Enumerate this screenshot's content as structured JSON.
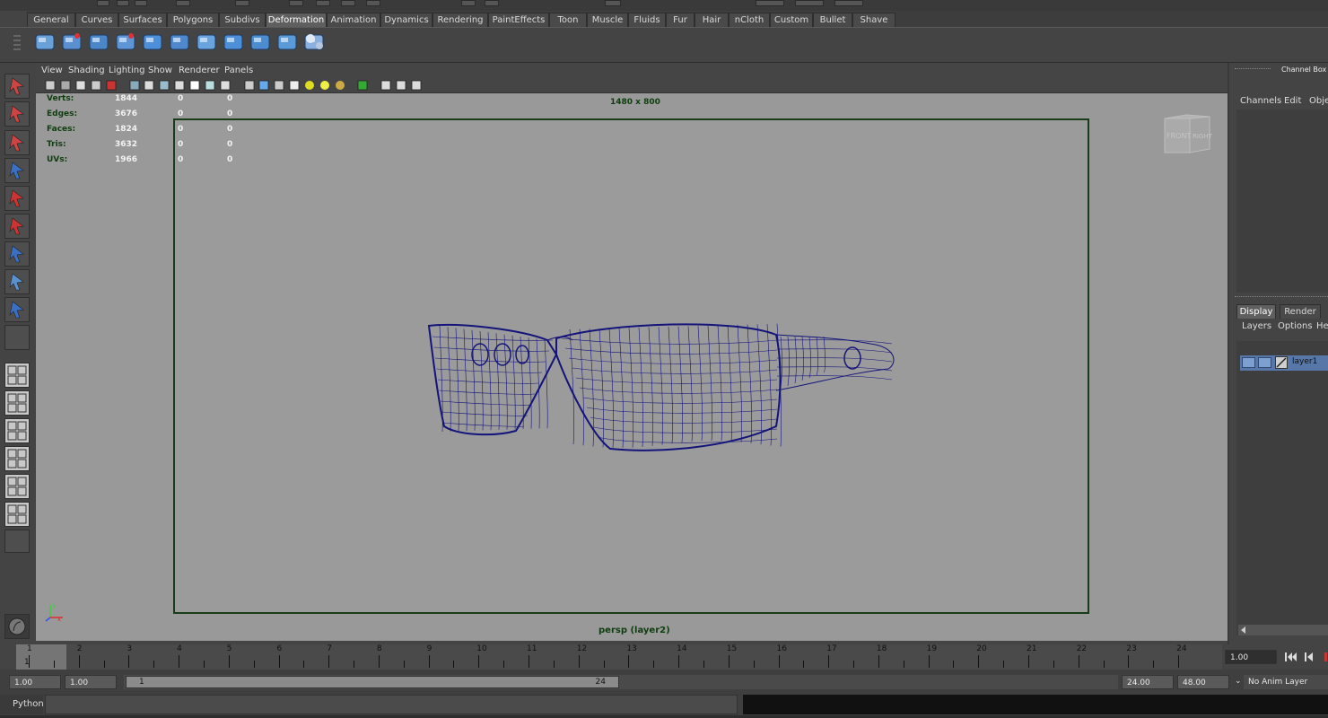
{
  "shelf_tabs": [
    "General",
    "Curves",
    "Surfaces",
    "Polygons",
    "Subdivs",
    "Deformation",
    "Animation",
    "Dynamics",
    "Rendering",
    "PaintEffects",
    "Toon",
    "Muscle",
    "Fluids",
    "Fur",
    "Hair",
    "nCloth",
    "Custom",
    "Bullet",
    "Shave"
  ],
  "active_shelf_tab": "Deformation",
  "shelf_icons": [
    "lattice-icon",
    "cluster-cylinder-icon",
    "bend-icon",
    "sculpt-icon",
    "blend-shape-icon",
    "wrap-icon",
    "wire-icon",
    "cube-deformer-icon",
    "soft-mod-icon",
    "curve-deformer-icon",
    "sphere-group-icon"
  ],
  "viewport": {
    "menu": [
      "View",
      "Shading",
      "Lighting",
      "Show",
      "Renderer",
      "Panels"
    ],
    "resolution_label": "1480 x 800",
    "camera_label": "persp (layer2)",
    "view_cube_labels": [
      "FRONT",
      "RIGHT"
    ],
    "stats": [
      {
        "label": "Verts:",
        "value": "1844",
        "sel": "0",
        "sel2": "0"
      },
      {
        "label": "Edges:",
        "value": "3676",
        "sel": "0",
        "sel2": "0"
      },
      {
        "label": "Faces:",
        "value": "1824",
        "sel": "0",
        "sel2": "0"
      },
      {
        "label": "Tris:",
        "value": "3632",
        "sel": "0",
        "sel2": "0"
      },
      {
        "label": "UVs:",
        "value": "1966",
        "sel": "0",
        "sel2": "0"
      }
    ],
    "wire_color": "#14147a",
    "background": "#999999"
  },
  "channel_box": {
    "title": "Channel Box / L",
    "menu": [
      "Channels",
      "Edit",
      "Obje"
    ]
  },
  "layer_editor": {
    "tabs": [
      "Display",
      "Render"
    ],
    "menu": [
      "Layers",
      "Options",
      "He"
    ],
    "layer_name": "layer1"
  },
  "timeline": {
    "numbers": [
      "1",
      "2",
      "3",
      "4",
      "5",
      "6",
      "7",
      "8",
      "9",
      "10",
      "11",
      "12",
      "13",
      "14",
      "15",
      "16",
      "17",
      "18",
      "19",
      "20",
      "21",
      "22",
      "23",
      "24"
    ],
    "current_frame": "1",
    "current_time_field": "1.00"
  },
  "range": {
    "start": "1.00",
    "playback_start": "1.00",
    "slider_start": "1",
    "slider_end": "24",
    "playback_end": "24.00",
    "end": "48.00",
    "anim_layer": "No Anim Layer"
  },
  "command_line": {
    "label": "Python"
  }
}
